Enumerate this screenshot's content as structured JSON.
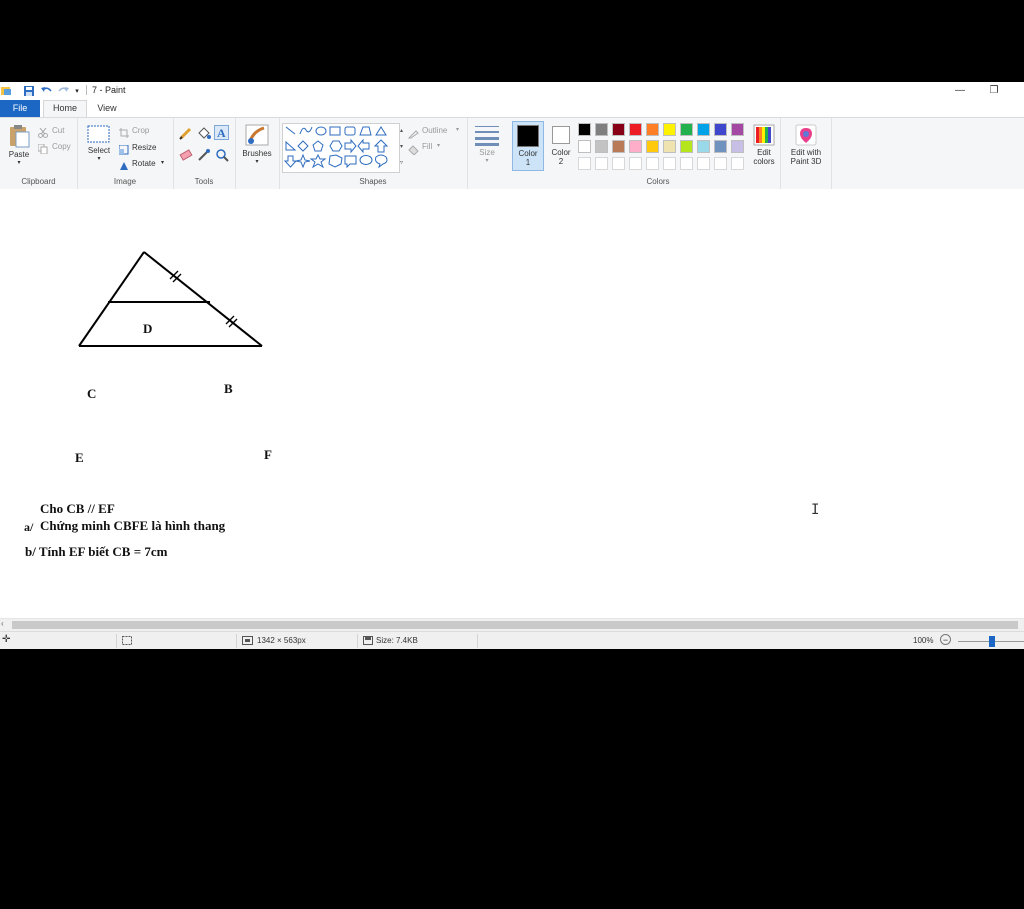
{
  "window": {
    "title": "7 - Paint",
    "minimize_glyph": "—",
    "restore_glyph": "❐"
  },
  "tabs": {
    "file": "File",
    "home": "Home",
    "view": "View"
  },
  "ribbon": {
    "clipboard": {
      "label": "Clipboard",
      "paste": "Paste",
      "cut": "Cut",
      "copy": "Copy"
    },
    "image": {
      "label": "Image",
      "select": "Select",
      "crop": "Crop",
      "resize": "Resize",
      "rotate": "Rotate"
    },
    "tools": {
      "label": "Tools"
    },
    "brushes": {
      "label": "Brushes"
    },
    "shapes": {
      "label": "Shapes",
      "outline": "Outline",
      "fill": "Fill"
    },
    "size": {
      "label": "Size"
    },
    "color1": {
      "label": "Color",
      "num": "1"
    },
    "color2": {
      "label": "Color",
      "num": "2"
    },
    "colors": {
      "label": "Colors",
      "row1": [
        "#000000",
        "#7f7f7f",
        "#880015",
        "#ed1c24",
        "#ff7f27",
        "#fff200",
        "#22b14c",
        "#00a2e8",
        "#3f48cc",
        "#a349a4"
      ],
      "row2": [
        "#ffffff",
        "#c3c3c3",
        "#b97a57",
        "#ffaec9",
        "#ffc90e",
        "#efe4b0",
        "#b5e61d",
        "#99d9ea",
        "#7092be",
        "#c8bfe7"
      ]
    },
    "edit_colors": {
      "line1": "Edit",
      "line2": "colors"
    },
    "paint3d": {
      "line1": "Edit with",
      "line2": "Paint 3D"
    }
  },
  "canvas": {
    "labels": {
      "D": "D",
      "C": "C",
      "B": "B",
      "E": "E",
      "F": "F"
    },
    "text": {
      "given": "Cho CB // EF",
      "a_prefix": "a/",
      "a_text": "Chứng minh CBFE là hình thang",
      "b_text": "b/ Tính EF biết CB = 7cm"
    }
  },
  "status": {
    "dimensions": "1342 × 563px",
    "size": "Size: 7.4KB",
    "zoom": "100%"
  }
}
